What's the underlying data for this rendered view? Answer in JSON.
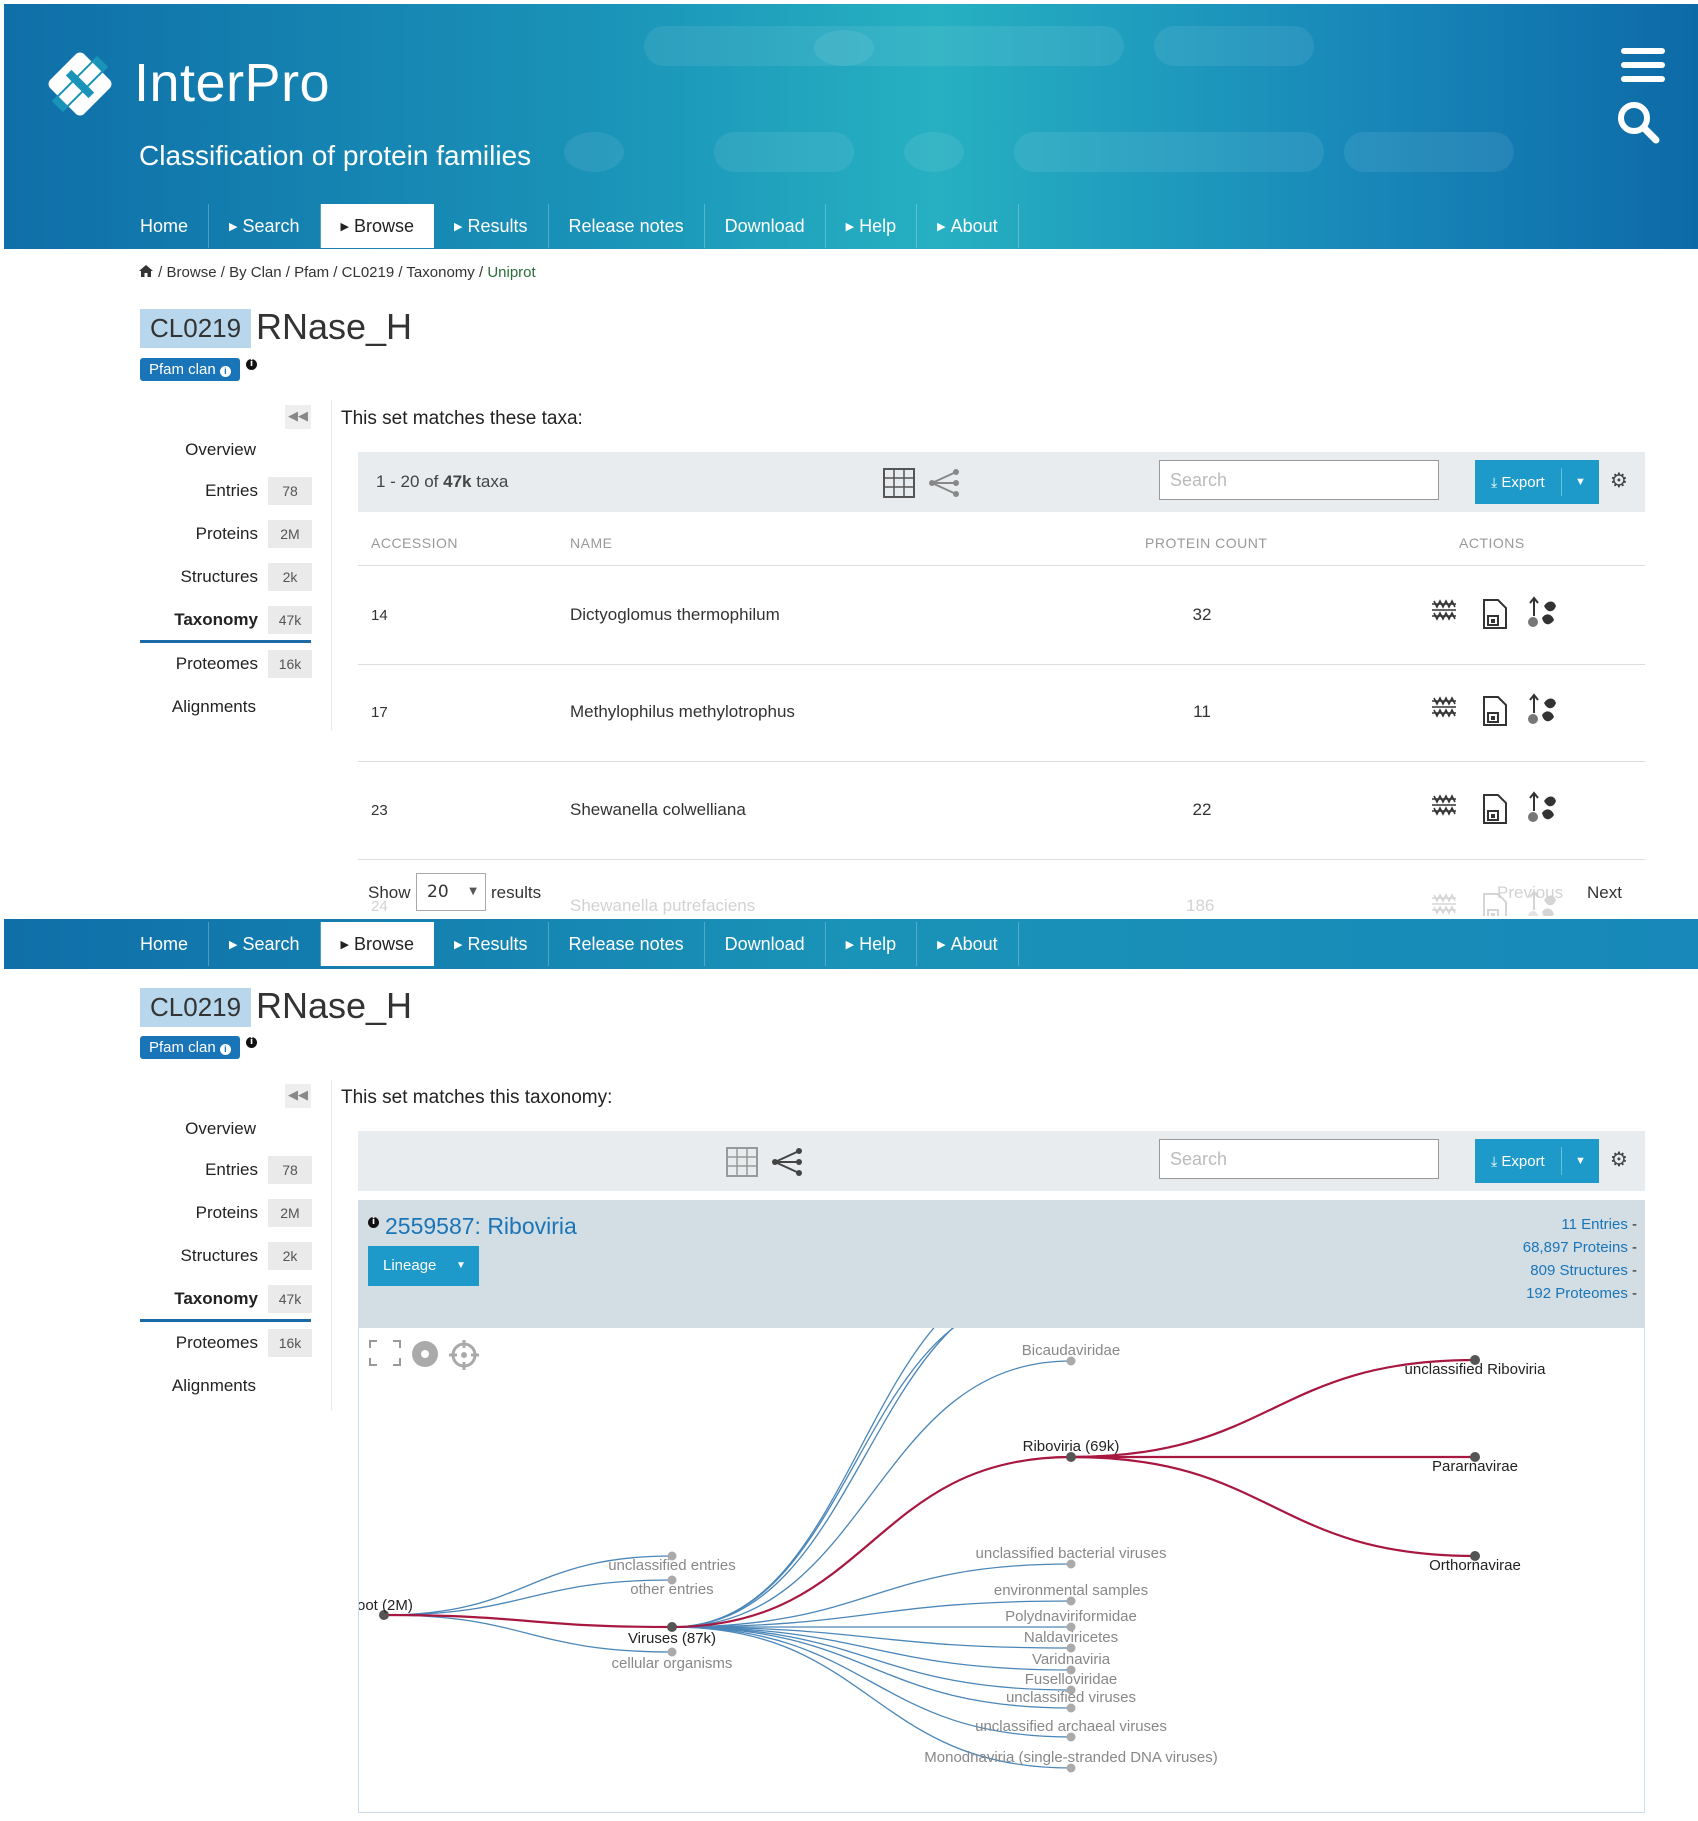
{
  "header": {
    "logo_text": "InterPro",
    "subtitle": "Classification of protein families"
  },
  "nav": [
    {
      "label": "Home",
      "arrow": false
    },
    {
      "label": "Search",
      "arrow": true
    },
    {
      "label": "Browse",
      "arrow": true,
      "active": true
    },
    {
      "label": "Results",
      "arrow": true
    },
    {
      "label": "Release notes",
      "arrow": false
    },
    {
      "label": "Download",
      "arrow": false
    },
    {
      "label": "Help",
      "arrow": true
    },
    {
      "label": "About",
      "arrow": true
    }
  ],
  "breadcrumb": {
    "sep": " / ",
    "items": [
      "Browse",
      "By Clan",
      "Pfam",
      "CL0219",
      "Taxonomy"
    ],
    "last": "Uniprot"
  },
  "entry": {
    "accession": "CL0219",
    "name": "RNase_H",
    "type_tag": "Pfam clan",
    "info_glyph": "i"
  },
  "sidebar": {
    "items": [
      {
        "label": "Overview",
        "count": ""
      },
      {
        "label": "Entries",
        "count": "78"
      },
      {
        "label": "Proteins",
        "count": "2M"
      },
      {
        "label": "Structures",
        "count": "2k"
      },
      {
        "label": "Taxonomy",
        "count": "47k",
        "active": true
      },
      {
        "label": "Proteomes",
        "count": "16k"
      },
      {
        "label": "Alignments",
        "count": ""
      }
    ]
  },
  "table_view": {
    "heading": "This set matches these taxa:",
    "range_text": "1 - 20 of ",
    "range_bold": "47k",
    "range_suffix": " taxa",
    "search_placeholder": "Search",
    "export_label": "Export",
    "columns": [
      "ACCESSION",
      "NAME",
      "PROTEIN COUNT",
      "ACTIONS"
    ],
    "rows": [
      {
        "accession": "14",
        "name": "Dictyoglomus thermophilum",
        "count": "32"
      },
      {
        "accession": "17",
        "name": "Methylophilus methylotrophus",
        "count": "11"
      },
      {
        "accession": "23",
        "name": "Shewanella colwelliana",
        "count": "22"
      }
    ],
    "faded_row": {
      "accession": "24",
      "name": "Shewanella putrefaciens",
      "count": "186"
    },
    "show_label": "Show",
    "show_value": "20",
    "results_label": "results",
    "previous_label": "Previous",
    "next_label": "Next"
  },
  "tree_view": {
    "heading": "This set matches this taxonomy:",
    "search_placeholder": "Search",
    "export_label": "Export",
    "taxon_title": "2559587: Riboviria",
    "lineage_label": "Lineage",
    "stats": [
      "11 Entries",
      "68,897 Proteins",
      "809 Structures",
      "192 Proteomes"
    ],
    "stat_suffix": " -",
    "nodes": {
      "root": "oot (2M)",
      "unclassified_entries": "unclassified entries",
      "other_entries": "other entries",
      "viruses": "Viruses (87k)",
      "cellular": "cellular organisms",
      "bicauda": "Bicaudaviridae",
      "riboviria": "Riboviria (69k)",
      "unclassified_bacterial": "unclassified bacterial viruses",
      "environmental": "environmental samples",
      "polydna": "Polydnaviriformidae",
      "naldav": "Naldaviricetes",
      "varidna": "Varidnaviria",
      "fusello": "Fuselloviridae",
      "unclassified_viruses": "unclassified viruses",
      "unclassified_archaeal": "unclassified archaeal viruses",
      "monodna": "Monodnaviria (single-stranded DNA viruses)",
      "unclassified_riboviria": "unclassified Riboviria",
      "pararna": "Pararnavirae",
      "orthorna": "Orthornavirae"
    }
  },
  "colors": {
    "accent": "#1a74b8",
    "button": "#1d9ac9",
    "lineage_path": "#a8173f",
    "tree_branch": "#4a86b8"
  },
  "icons": [
    "home-icon",
    "table-view-icon",
    "tree-view-icon",
    "gear-icon",
    "download-icon",
    "caret-down-icon",
    "collapse-left-icon",
    "info-icon",
    "alignment-icon",
    "save-fasta-icon",
    "taxonomy-tree-icon",
    "fullscreen-icon",
    "record-icon",
    "crosshair-icon",
    "menu-icon",
    "search-icon"
  ]
}
